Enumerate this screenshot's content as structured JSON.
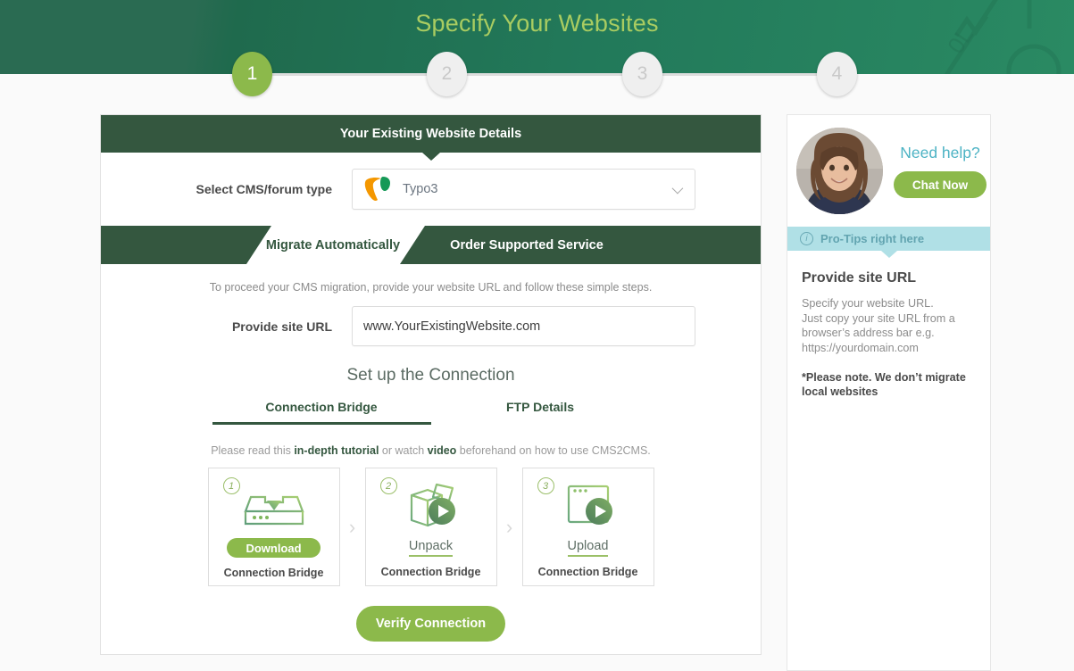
{
  "header": {
    "title": "Specify Your Websites"
  },
  "stepper": {
    "steps": [
      {
        "label": "1",
        "state": "active"
      },
      {
        "label": "2",
        "state": "inactive"
      },
      {
        "label": "3",
        "state": "inactive"
      },
      {
        "label": "4",
        "state": "inactive"
      }
    ]
  },
  "main": {
    "card_title": "Your Existing Website Details",
    "cms": {
      "label": "Select CMS/forum type",
      "selected": "Typo3",
      "logo": "typo3-logo"
    },
    "tabs": [
      {
        "label": "Migrate Automatically",
        "active": true
      },
      {
        "label": "Order Supported Service",
        "active": false
      }
    ],
    "intro": "To proceed your CMS migration, provide your website URL and follow these simple steps.",
    "url": {
      "label": "Provide site URL",
      "value": "www.YourExistingWebsite.com",
      "placeholder": "www.YourExistingWebsite.com"
    },
    "setup_title": "Set up the Connection",
    "sub_tabs": [
      {
        "label": "Connection Bridge",
        "active": true
      },
      {
        "label": "FTP Details",
        "active": false
      }
    ],
    "tutorial": {
      "prefix": "Please read this ",
      "link1": "in-depth tutorial",
      "middle": " or watch ",
      "link2": "video",
      "suffix": " beforehand on how to use CMS2CMS."
    },
    "step_cards": [
      {
        "num": "1",
        "action": "Download",
        "action_type": "button",
        "caption": "Connection Bridge",
        "icon": "download-box-icon"
      },
      {
        "num": "2",
        "action": "Unpack",
        "action_type": "link",
        "caption": "Connection Bridge",
        "icon": "open-box-play-icon"
      },
      {
        "num": "3",
        "action": "Upload",
        "action_type": "link",
        "caption": "Connection Bridge",
        "icon": "browser-window-play-icon"
      }
    ],
    "chevron": "›",
    "verify_label": "Verify Connection"
  },
  "sidebar": {
    "help_title": "Need help?",
    "chat_label": "Chat Now",
    "protips_label": "Pro-Tips right here",
    "info_glyph": "i",
    "tips_heading": "Provide site URL",
    "tips_body": "Specify your website URL.\nJust copy your site URL from a browser’s address bar e.g.\nhttps://yourdomain.com",
    "tips_note": "*Please note. We don’t migrate local websites"
  },
  "colors": {
    "header_green": "#236a4f",
    "title_green": "#a9cc61",
    "card_header_green": "#34573f",
    "accent_green": "#8cb94b",
    "protips_cyan": "#b0e0e6",
    "help_blue": "#4db3c4"
  }
}
